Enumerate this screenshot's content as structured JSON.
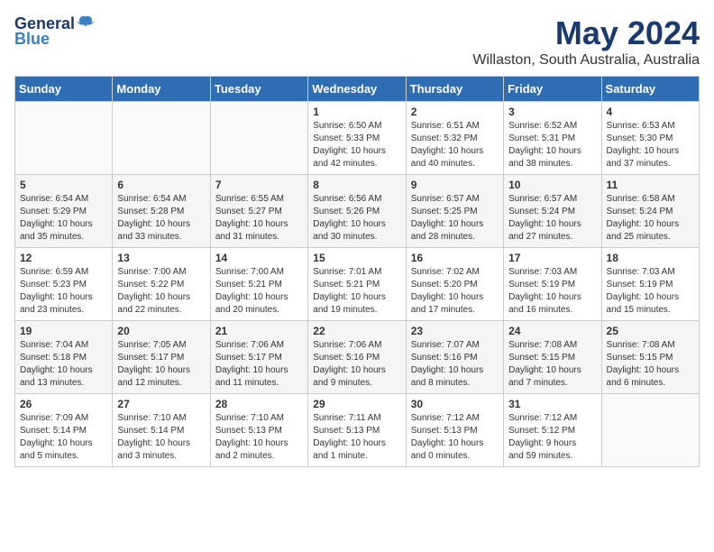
{
  "logo": {
    "text1": "General",
    "text2": "Blue"
  },
  "title": "May 2024",
  "subtitle": "Willaston, South Australia, Australia",
  "days_of_week": [
    "Sunday",
    "Monday",
    "Tuesday",
    "Wednesday",
    "Thursday",
    "Friday",
    "Saturday"
  ],
  "weeks": [
    [
      {
        "day": "",
        "info": ""
      },
      {
        "day": "",
        "info": ""
      },
      {
        "day": "",
        "info": ""
      },
      {
        "day": "1",
        "info": "Sunrise: 6:50 AM\nSunset: 5:33 PM\nDaylight: 10 hours\nand 42 minutes."
      },
      {
        "day": "2",
        "info": "Sunrise: 6:51 AM\nSunset: 5:32 PM\nDaylight: 10 hours\nand 40 minutes."
      },
      {
        "day": "3",
        "info": "Sunrise: 6:52 AM\nSunset: 5:31 PM\nDaylight: 10 hours\nand 38 minutes."
      },
      {
        "day": "4",
        "info": "Sunrise: 6:53 AM\nSunset: 5:30 PM\nDaylight: 10 hours\nand 37 minutes."
      }
    ],
    [
      {
        "day": "5",
        "info": "Sunrise: 6:54 AM\nSunset: 5:29 PM\nDaylight: 10 hours\nand 35 minutes."
      },
      {
        "day": "6",
        "info": "Sunrise: 6:54 AM\nSunset: 5:28 PM\nDaylight: 10 hours\nand 33 minutes."
      },
      {
        "day": "7",
        "info": "Sunrise: 6:55 AM\nSunset: 5:27 PM\nDaylight: 10 hours\nand 31 minutes."
      },
      {
        "day": "8",
        "info": "Sunrise: 6:56 AM\nSunset: 5:26 PM\nDaylight: 10 hours\nand 30 minutes."
      },
      {
        "day": "9",
        "info": "Sunrise: 6:57 AM\nSunset: 5:25 PM\nDaylight: 10 hours\nand 28 minutes."
      },
      {
        "day": "10",
        "info": "Sunrise: 6:57 AM\nSunset: 5:24 PM\nDaylight: 10 hours\nand 27 minutes."
      },
      {
        "day": "11",
        "info": "Sunrise: 6:58 AM\nSunset: 5:24 PM\nDaylight: 10 hours\nand 25 minutes."
      }
    ],
    [
      {
        "day": "12",
        "info": "Sunrise: 6:59 AM\nSunset: 5:23 PM\nDaylight: 10 hours\nand 23 minutes."
      },
      {
        "day": "13",
        "info": "Sunrise: 7:00 AM\nSunset: 5:22 PM\nDaylight: 10 hours\nand 22 minutes."
      },
      {
        "day": "14",
        "info": "Sunrise: 7:00 AM\nSunset: 5:21 PM\nDaylight: 10 hours\nand 20 minutes."
      },
      {
        "day": "15",
        "info": "Sunrise: 7:01 AM\nSunset: 5:21 PM\nDaylight: 10 hours\nand 19 minutes."
      },
      {
        "day": "16",
        "info": "Sunrise: 7:02 AM\nSunset: 5:20 PM\nDaylight: 10 hours\nand 17 minutes."
      },
      {
        "day": "17",
        "info": "Sunrise: 7:03 AM\nSunset: 5:19 PM\nDaylight: 10 hours\nand 16 minutes."
      },
      {
        "day": "18",
        "info": "Sunrise: 7:03 AM\nSunset: 5:19 PM\nDaylight: 10 hours\nand 15 minutes."
      }
    ],
    [
      {
        "day": "19",
        "info": "Sunrise: 7:04 AM\nSunset: 5:18 PM\nDaylight: 10 hours\nand 13 minutes."
      },
      {
        "day": "20",
        "info": "Sunrise: 7:05 AM\nSunset: 5:17 PM\nDaylight: 10 hours\nand 12 minutes."
      },
      {
        "day": "21",
        "info": "Sunrise: 7:06 AM\nSunset: 5:17 PM\nDaylight: 10 hours\nand 11 minutes."
      },
      {
        "day": "22",
        "info": "Sunrise: 7:06 AM\nSunset: 5:16 PM\nDaylight: 10 hours\nand 9 minutes."
      },
      {
        "day": "23",
        "info": "Sunrise: 7:07 AM\nSunset: 5:16 PM\nDaylight: 10 hours\nand 8 minutes."
      },
      {
        "day": "24",
        "info": "Sunrise: 7:08 AM\nSunset: 5:15 PM\nDaylight: 10 hours\nand 7 minutes."
      },
      {
        "day": "25",
        "info": "Sunrise: 7:08 AM\nSunset: 5:15 PM\nDaylight: 10 hours\nand 6 minutes."
      }
    ],
    [
      {
        "day": "26",
        "info": "Sunrise: 7:09 AM\nSunset: 5:14 PM\nDaylight: 10 hours\nand 5 minutes."
      },
      {
        "day": "27",
        "info": "Sunrise: 7:10 AM\nSunset: 5:14 PM\nDaylight: 10 hours\nand 3 minutes."
      },
      {
        "day": "28",
        "info": "Sunrise: 7:10 AM\nSunset: 5:13 PM\nDaylight: 10 hours\nand 2 minutes."
      },
      {
        "day": "29",
        "info": "Sunrise: 7:11 AM\nSunset: 5:13 PM\nDaylight: 10 hours\nand 1 minute."
      },
      {
        "day": "30",
        "info": "Sunrise: 7:12 AM\nSunset: 5:13 PM\nDaylight: 10 hours\nand 0 minutes."
      },
      {
        "day": "31",
        "info": "Sunrise: 7:12 AM\nSunset: 5:12 PM\nDaylight: 9 hours\nand 59 minutes."
      },
      {
        "day": "",
        "info": ""
      }
    ]
  ]
}
